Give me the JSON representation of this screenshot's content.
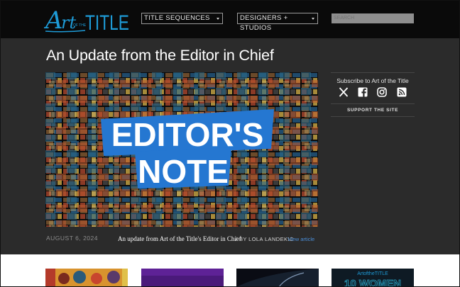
{
  "header": {
    "logo_text": "Art of the TITLE",
    "nav": [
      {
        "label": "TITLE SEQUENCES"
      },
      {
        "label": "DESIGNERS + STUDIOS"
      }
    ],
    "search": {
      "placeholder": "SEARCH"
    }
  },
  "article": {
    "title": "An Update from the Editor in Chief",
    "hero_text_line1": "EDITOR'S",
    "hero_text_line2": "NOTE",
    "date": "AUGUST 6, 2024",
    "caption": "An update from Art of the Title's Editor in Chief",
    "byline": "/ BY LOLA LANDEKIC",
    "view_link": "View article"
  },
  "sidebar": {
    "subscribe": "Subscribe to Art of the Title",
    "social_icons": [
      "x-icon",
      "facebook-icon",
      "instagram-icon",
      "rss-icon"
    ],
    "support": "SUPPORT THE SITE"
  },
  "thumbnails": {
    "fourth_logo_text": "ArtoftheTITLE",
    "fourth_big_text": "10 WOMEN"
  },
  "colors": {
    "brand_blue": "#1e9bd7",
    "hero_blue": "#2577d1",
    "page_bg": "#2b2b2b",
    "header_bg": "#0a0a0a",
    "link_blue": "#4a8ed8"
  }
}
